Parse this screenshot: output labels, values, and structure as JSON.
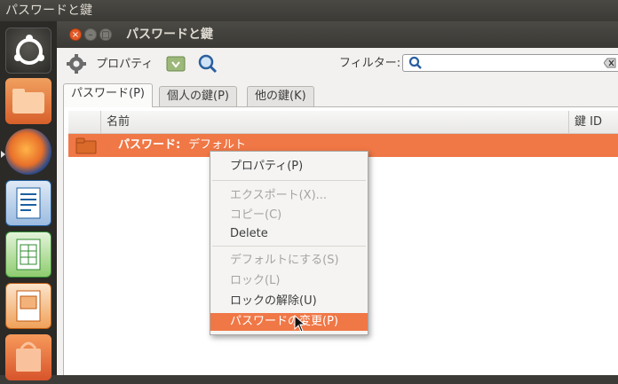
{
  "topbar": {
    "title": "パスワードと鍵"
  },
  "launcher": {
    "items": [
      "dash-home",
      "files",
      "firefox",
      "libreoffice-writer",
      "libreoffice-calc",
      "libreoffice-impress",
      "software-center"
    ]
  },
  "window": {
    "title": "パスワードと鍵",
    "toolbar": {
      "properties_label": "プロパティ",
      "filter_label": "フィルター:",
      "filter_value": ""
    },
    "tabs": [
      "パスワード(P)",
      "個人の鍵(P)",
      "他の鍵(K)"
    ],
    "columns": {
      "name": "名前",
      "key_id": "鍵 ID"
    },
    "rows": [
      {
        "prefix": "パスワード:",
        "name": "デフォルト"
      }
    ]
  },
  "context_menu": {
    "items": [
      {
        "label": "プロパティ(P)",
        "enabled": true
      },
      {
        "label": "エクスポート(X)...",
        "enabled": false
      },
      {
        "label": "コピー(C)",
        "enabled": false
      },
      {
        "label": "Delete",
        "enabled": true
      },
      {
        "label": "デフォルトにする(S)",
        "enabled": false
      },
      {
        "label": "ロック(L)",
        "enabled": false
      },
      {
        "label": "ロックの解除(U)",
        "enabled": true
      },
      {
        "label": "パスワードの変更(P)",
        "enabled": true,
        "highlighted": true
      }
    ]
  },
  "colors": {
    "accent": "#f07746",
    "panel": "#3c3b37"
  }
}
